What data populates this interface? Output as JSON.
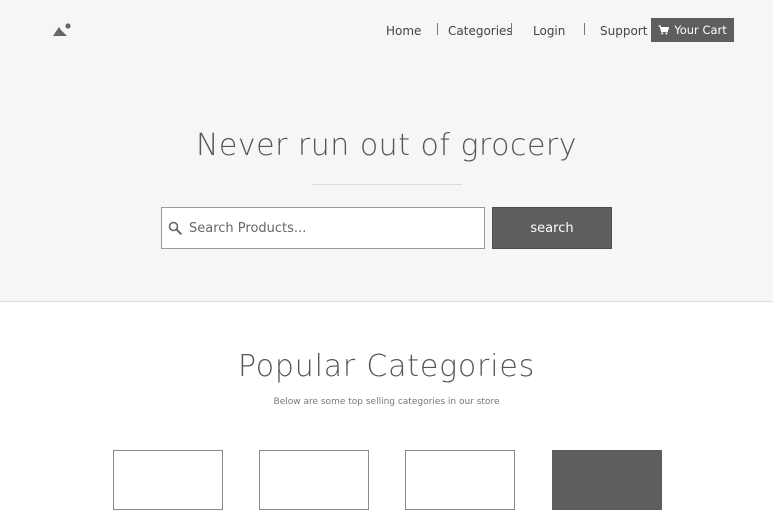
{
  "header": {
    "logo_icon": "mountain-sun-logo-icon",
    "nav": {
      "home": "Home",
      "categories": "Categories",
      "login": "Login",
      "support": "Support"
    },
    "cart": {
      "icon": "cart-icon",
      "label": "Your Cart"
    }
  },
  "hero": {
    "title": "Never run out of grocery",
    "search": {
      "icon": "search-icon",
      "placeholder": "Search Products...",
      "value": "",
      "button_label": "search"
    }
  },
  "popular": {
    "title": "Popular Categories",
    "subtitle": "Below are some top selling categories in our store",
    "cards": [
      {
        "style": "outline"
      },
      {
        "style": "outline"
      },
      {
        "style": "outline"
      },
      {
        "style": "filled"
      }
    ]
  },
  "colors": {
    "hero_bg": "#f6f6f6",
    "button_bg": "#5e5e5e",
    "text": "#555555"
  }
}
